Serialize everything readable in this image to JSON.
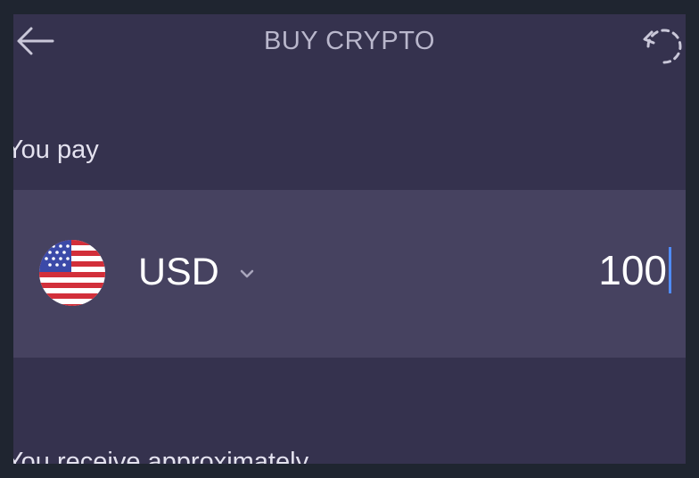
{
  "header": {
    "title": "BUY CRYPTO",
    "back_icon": "arrow-left-icon",
    "refresh_icon": "refresh-icon"
  },
  "pay": {
    "label": "You pay",
    "currency": {
      "code": "USD",
      "flag_icon": "us-flag-icon",
      "dropdown_icon": "chevron-down-icon"
    },
    "amount": "100"
  },
  "receive": {
    "label": "You receive approximately"
  },
  "colors": {
    "background": "#35324e",
    "row": "#464260",
    "caret": "#4f8cff",
    "title": "#b9b7cc"
  }
}
